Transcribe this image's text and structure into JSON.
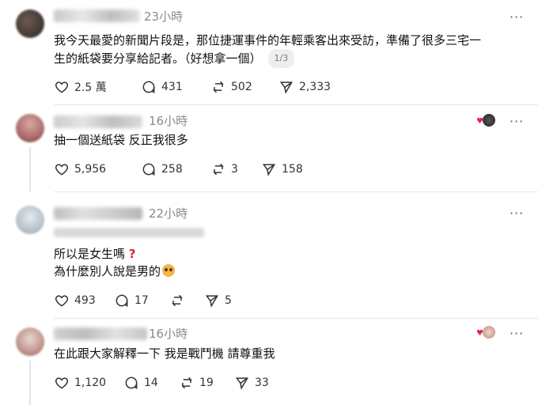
{
  "posts": [
    {
      "time": "23小時",
      "lines": [
        "我今天最愛的新聞片段是，那位捷運事件的年輕乘客出來受訪，準備了很多三宅一",
        "生的紙袋要分享給記者。（好想拿一個）"
      ],
      "pager": "1/3",
      "likes": "2.5 萬",
      "comments": "431",
      "reposts": "502",
      "shares": "2,333",
      "more": "···"
    },
    {
      "time": "16小時",
      "lines": [
        "抽一個送紙袋 反正我很多"
      ],
      "likes": "5,956",
      "comments": "258",
      "reposts": "3",
      "shares": "158",
      "more": "···"
    },
    {
      "time": "22小時",
      "lines": [
        "所以是女生嗎",
        "為什麼別人說是男的"
      ],
      "emoji_question": "?",
      "likes": "493",
      "comments": "17",
      "reposts": "",
      "shares": "5",
      "more": "···"
    },
    {
      "time": "16小時",
      "lines": [
        "在此跟大家解釋一下 我是戰鬥機 請尊重我"
      ],
      "likes": "1,120",
      "comments": "14",
      "reposts": "19",
      "shares": "33",
      "more": "···"
    }
  ],
  "icons": {
    "like": "heart-outline-icon",
    "comment": "speech-bubble-icon",
    "repost": "repost-arrows-icon",
    "share": "paper-plane-icon",
    "more": "more-dots-icon"
  },
  "colors": {
    "heart_red": "#e8264b",
    "muted_text": "#8a8a8a"
  }
}
